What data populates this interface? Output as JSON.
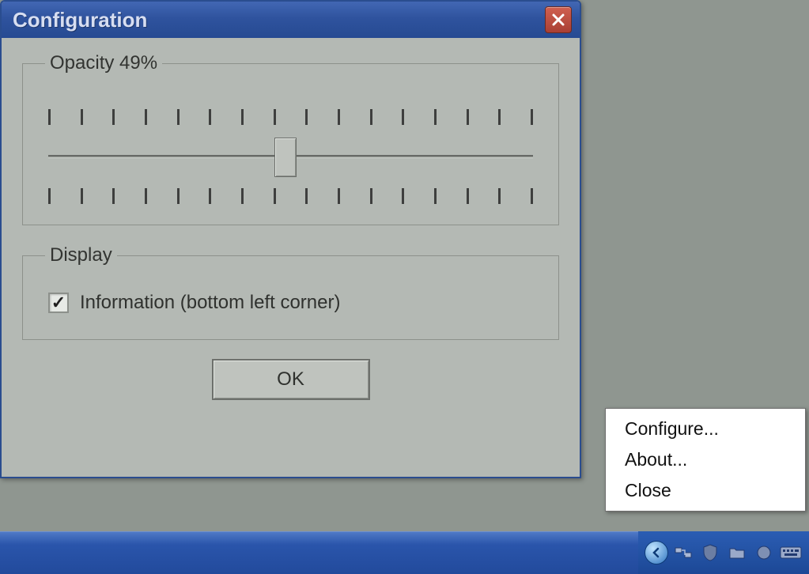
{
  "window": {
    "title": "Configuration"
  },
  "opacity": {
    "label": "Opacity 49%",
    "percent": 49
  },
  "display": {
    "legend": "Display",
    "info_label": "Information (bottom left corner)",
    "info_checked": true
  },
  "buttons": {
    "ok": "OK"
  },
  "context_menu": {
    "items": [
      "Configure...",
      "About...",
      "Close"
    ]
  },
  "tray": {
    "icons": [
      "chevron-left",
      "network",
      "shield",
      "folder",
      "circle",
      "keyboard"
    ]
  }
}
